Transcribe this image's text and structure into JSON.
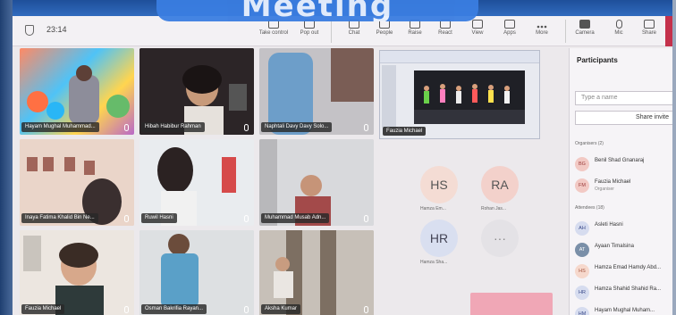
{
  "meeting": {
    "timer": "23:14",
    "title_partial": "Meeting"
  },
  "toolbar": {
    "items": [
      {
        "label": "Take control",
        "icon": "take-control-icon"
      },
      {
        "label": "Pop out",
        "icon": "pop-out-icon"
      },
      {
        "label": "Chat",
        "icon": "chat-icon"
      },
      {
        "label": "People",
        "icon": "people-icon"
      },
      {
        "label": "Raise",
        "icon": "raise-hand-icon"
      },
      {
        "label": "React",
        "icon": "react-icon"
      },
      {
        "label": "View",
        "icon": "view-icon"
      },
      {
        "label": "Apps",
        "icon": "apps-icon"
      },
      {
        "label": "More",
        "icon": "more-icon"
      },
      {
        "label": "Camera",
        "icon": "camera-icon"
      },
      {
        "label": "Mic",
        "icon": "mic-icon"
      },
      {
        "label": "Share",
        "icon": "share-icon"
      }
    ]
  },
  "tiles": [
    {
      "name": "Hayam Mughal Muhammad..."
    },
    {
      "name": "Hibah Habibur Rahman"
    },
    {
      "name": "Naphtali Davy Davy Solo..."
    },
    {
      "name": "Inaya Fatima Khalid Bin Ne..."
    },
    {
      "name": "Ruwil Hasni"
    },
    {
      "name": "Muhammad Musab Adn..."
    },
    {
      "name": "Fauzia Michael"
    },
    {
      "name": "Osman Bakrifia Rayan..."
    },
    {
      "name": "Aksha Kumar"
    }
  ],
  "shared_screen": {
    "presenter": "Fauzia Michael"
  },
  "avatars": [
    {
      "initials": "HS",
      "caption": "Hamza Em..."
    },
    {
      "initials": "RA",
      "caption": "Rohan Jas..."
    },
    {
      "initials": "HR",
      "caption": "Hamza Sha..."
    },
    {
      "initials": "···",
      "caption": ""
    }
  ],
  "participants": {
    "title": "Participants",
    "search_placeholder": "Type a name",
    "share_invite": "Share invite",
    "organisers_label": "Organisers (2)",
    "attendees_label": "Attendees (18)",
    "organisers": [
      {
        "initials": "BG",
        "name": "Benil Shad Gnanaraj",
        "role": ""
      },
      {
        "initials": "FM",
        "name": "Fauzia Michael",
        "role": "Organiser"
      }
    ],
    "attendees": [
      {
        "initials": "AH",
        "name": "Asleti Hasni"
      },
      {
        "initials": "AT",
        "name": "Ayaan Timalsina"
      },
      {
        "initials": "HS",
        "name": "Hamza Emad Hamdy Abd..."
      },
      {
        "initials": "HR",
        "name": "Hamza Shahid Shahid Ra..."
      },
      {
        "initials": "HM",
        "name": "Hayam Mughal Muham..."
      }
    ]
  },
  "colors": {
    "accent": "#3a7de0",
    "leave": "#c4314b"
  }
}
